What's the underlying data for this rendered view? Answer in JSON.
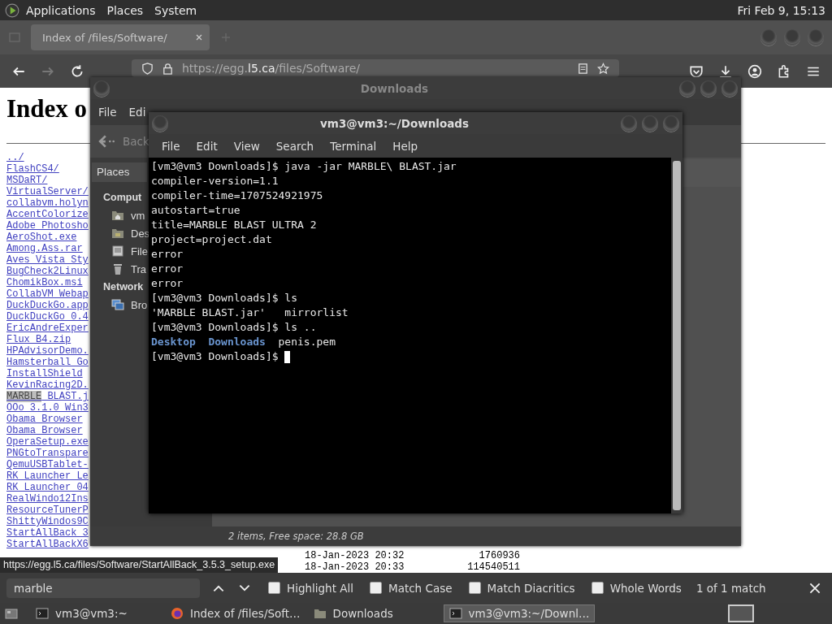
{
  "top_panel": {
    "menus": [
      "Applications",
      "Places",
      "System"
    ],
    "clock": "Fri Feb  9, 15:13"
  },
  "browser": {
    "tab": {
      "title": "Index of /files/Software/",
      "selected": true
    },
    "nav_buttons": [
      {
        "kind": "back",
        "disabled": false
      },
      {
        "kind": "forward",
        "disabled": true
      },
      {
        "kind": "reload",
        "disabled": false
      }
    ],
    "url_parts": [
      {
        "text": "https://egg.",
        "kind": "dim"
      },
      {
        "text": "l5.ca",
        "kind": "bright"
      },
      {
        "text": "/files/Software/",
        "kind": "dim"
      }
    ],
    "page": {
      "heading": "Index o",
      "listing": [
        {
          "link": "../"
        },
        {
          "link": "FlashCS4/"
        },
        {
          "link": "MSDaRT/"
        },
        {
          "link": "VirtualServer/"
        },
        {
          "link": "collabvm.holyn"
        },
        {
          "link": "AccentColorize"
        },
        {
          "link": "Adobe Photosho"
        },
        {
          "link": "AeroShot.exe"
        },
        {
          "link": "Among.Ass.rar"
        },
        {
          "link": "Aves Vista Sty"
        },
        {
          "link": "BugCheck2Linux"
        },
        {
          "link": "ChomikBox.msi"
        },
        {
          "link": "CollabVM Webap"
        },
        {
          "link": "DuckDuckGo.app"
        },
        {
          "link": "DuckDuckGo 0.4"
        },
        {
          "link": "EricAndreExper"
        },
        {
          "link": "Flux B4.zip"
        },
        {
          "link": "HPAdvisorDemo."
        },
        {
          "link": "Hamsterball Go"
        },
        {
          "link": "InstallShield"
        },
        {
          "link": "KevinRacing2D."
        },
        {
          "match": "MARBLE",
          "link": " BLAST.j"
        },
        {
          "link": "OOo_3.1.0_Win3"
        },
        {
          "link": "Obama Browser"
        },
        {
          "link": "Obama Browser"
        },
        {
          "link": "OperaSetup.exe"
        },
        {
          "link": "PNGtoTranspare"
        },
        {
          "link": "QemuUSBTablet-"
        },
        {
          "link": "RK Launcher Le"
        },
        {
          "link": "RK_Launcher_04"
        },
        {
          "link": "RealWindo12Ins"
        },
        {
          "link": "ResourceTunerP"
        },
        {
          "link": "ShittyWindos9C"
        },
        {
          "link": "StartAllBack 3"
        },
        {
          "link": "StartAllBackX6"
        },
        {
          "date": "18-Jan-2023 20:32",
          "size": "1760936"
        },
        {
          "date": "18-Jan-2023 20:33",
          "size": "114540511"
        }
      ],
      "status_link": "https://egg.l5.ca/files/Software/StartAllBack_3.5.3_setup.exe"
    },
    "find_bar": {
      "query": "marble",
      "options": [
        {
          "label": "Highlight All",
          "checked": false
        },
        {
          "label": "Match Case",
          "checked": false
        },
        {
          "label": "Match Diacritics",
          "checked": false
        },
        {
          "label": "Whole Words",
          "checked": false
        }
      ],
      "result": "1 of 1 match"
    }
  },
  "file_manager": {
    "title": "Downloads",
    "menus": [
      "File",
      "Edi"
    ],
    "back": "Back",
    "places": "Places",
    "sections": [
      {
        "title": "Comput",
        "items": [
          {
            "kind": "home",
            "label": "vm"
          },
          {
            "kind": "desktop",
            "label": "Des"
          },
          {
            "kind": "filesystem",
            "label": "File"
          },
          {
            "kind": "trash",
            "label": "Tra"
          }
        ]
      },
      {
        "title": "Network",
        "items": [
          {
            "kind": "network",
            "label": "Bro"
          }
        ]
      }
    ],
    "status": "2 items, Free space: 28.8 GB"
  },
  "terminal": {
    "title": "vm3@vm3:~/Downloads",
    "menus": [
      "File",
      "Edit",
      "View",
      "Search",
      "Terminal",
      "Help"
    ],
    "lines": [
      {
        "segments": [
          {
            "text": "[vm3@vm3 Downloads]$ java -jar MARBLE\\ BLAST.jar",
            "kind": "text"
          }
        ]
      },
      {
        "segments": [
          {
            "text": "compiler-version=1.1",
            "kind": "text"
          }
        ]
      },
      {
        "segments": [
          {
            "text": "compiler-time=1707524921975",
            "kind": "text"
          }
        ]
      },
      {
        "segments": [
          {
            "text": "autostart=true",
            "kind": "text"
          }
        ]
      },
      {
        "segments": [
          {
            "text": "title=MARBLE BLAST ULTRA 2",
            "kind": "text"
          }
        ]
      },
      {
        "segments": [
          {
            "text": "project=project.dat",
            "kind": "text"
          }
        ]
      },
      {
        "segments": [
          {
            "text": "error",
            "kind": "text"
          }
        ]
      },
      {
        "segments": [
          {
            "text": "error",
            "kind": "text"
          }
        ]
      },
      {
        "segments": [
          {
            "text": "error",
            "kind": "text"
          }
        ]
      },
      {
        "segments": [
          {
            "text": "[vm3@vm3 Downloads]$ ls",
            "kind": "text"
          }
        ]
      },
      {
        "segments": [
          {
            "text": "'MARBLE BLAST.jar'   mirrorlist",
            "kind": "text"
          }
        ]
      },
      {
        "segments": [
          {
            "text": "[vm3@vm3 Downloads]$ ls ..",
            "kind": "text"
          }
        ]
      },
      {
        "segments": [
          {
            "text": "Desktop",
            "kind": "dir"
          },
          {
            "text": "  Downloads",
            "kind": "dir"
          },
          {
            "text": "  penis.pem",
            "kind": "text"
          }
        ]
      },
      {
        "segments": [
          {
            "text": "[vm3@vm3 Downloads]$ ",
            "kind": "text"
          }
        ],
        "cursor": true
      }
    ]
  },
  "taskbar": {
    "items": [
      {
        "label": "vm3@vm3:~",
        "kind": "terminal",
        "selected": false
      },
      {
        "label": "Index of /files/Soft…",
        "kind": "browser",
        "selected": false
      },
      {
        "label": "Downloads",
        "kind": "folder",
        "selected": false
      },
      {
        "label": "vm3@vm3:~/Downl…",
        "kind": "terminal",
        "selected": true
      }
    ]
  }
}
